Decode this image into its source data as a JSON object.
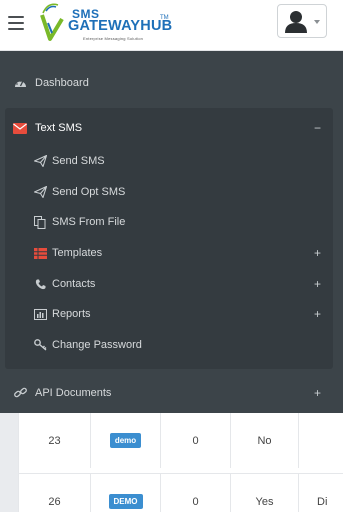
{
  "header": {
    "logo_line1": "SMS",
    "logo_line2": "GATEWAYHUB",
    "logo_tm": "TM",
    "logo_tagline": "Enterprise Messaging Solution"
  },
  "sidebar": {
    "items": [
      {
        "label": "Dashboard",
        "icon": "dashboard-icon"
      },
      {
        "label": "Text SMS",
        "icon": "envelope-icon",
        "expanded_mark": "−"
      },
      {
        "label": "API Documents",
        "icon": "link-icon",
        "expand_mark": "+"
      }
    ],
    "submenu": [
      {
        "label": "Send SMS",
        "icon": "paper-plane-icon"
      },
      {
        "label": "Send Opt SMS",
        "icon": "paper-plane-icon"
      },
      {
        "label": "SMS From File",
        "icon": "copy-file-icon"
      },
      {
        "label": "Templates",
        "icon": "table-icon",
        "expand_mark": "+"
      },
      {
        "label": "Contacts",
        "icon": "phone-icon",
        "expand_mark": "+"
      },
      {
        "label": "Reports",
        "icon": "bar-chart-icon",
        "expand_mark": "+"
      },
      {
        "label": "Change Password",
        "icon": "key-icon"
      }
    ]
  },
  "table": {
    "rows": [
      {
        "id": "23",
        "tag": "demo",
        "count": "0",
        "flag": "No",
        "extra": ""
      },
      {
        "id": "26",
        "tag": "DEMO",
        "count": "0",
        "flag": "Yes",
        "extra": "Di"
      }
    ]
  },
  "colors": {
    "sidebar_bg": "#3c4449",
    "submenu_bg": "#343b40",
    "accent_red": "#e74c3c",
    "badge_blue": "#3b8ed0",
    "logo_blue": "#1d6fb8",
    "logo_green": "#7ab929"
  }
}
